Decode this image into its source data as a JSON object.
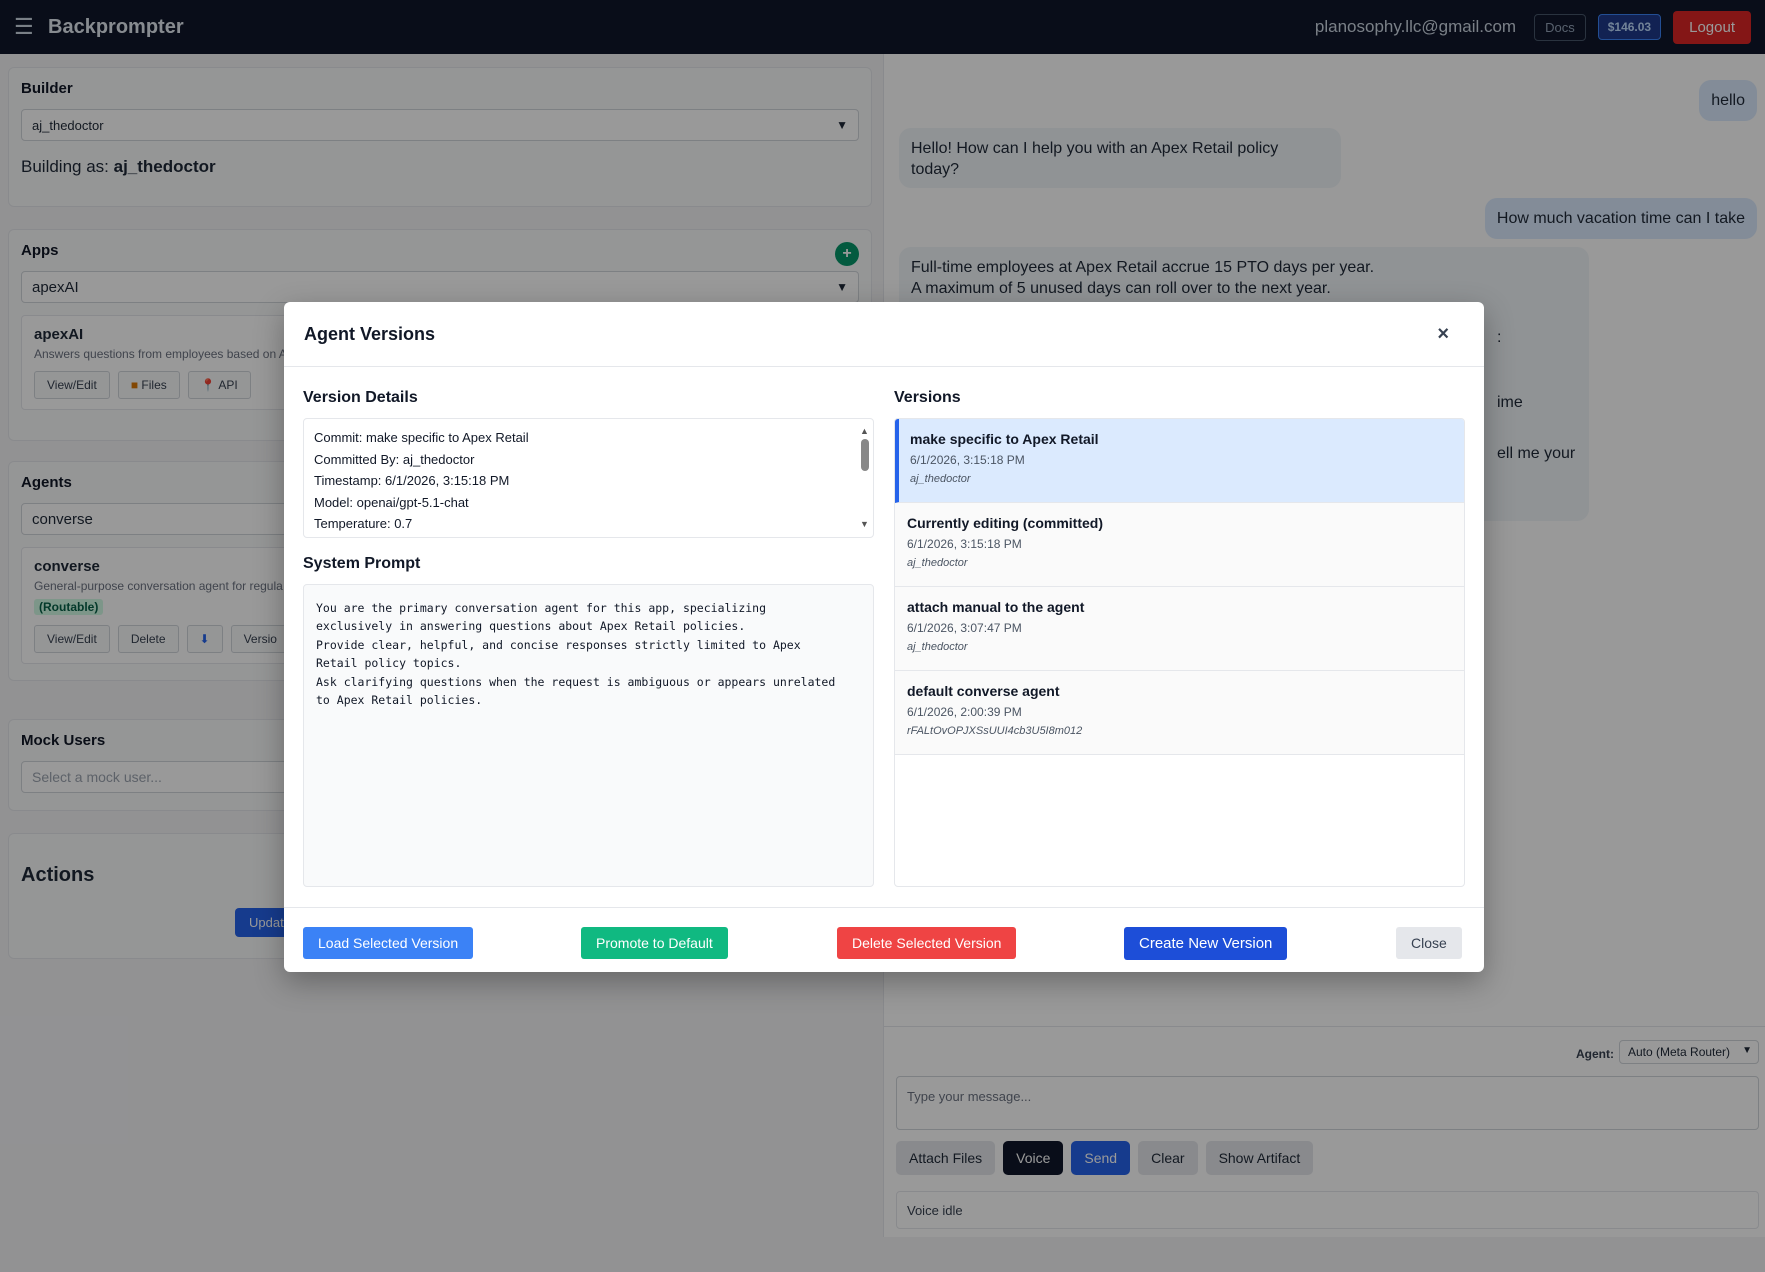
{
  "header": {
    "brand": "Backprompter",
    "email": "planosophy.llc@gmail.com",
    "docs_label": "Docs",
    "balance": "$146.03",
    "logout_label": "Logout"
  },
  "builder": {
    "title": "Builder",
    "selected": "aj_thedoctor",
    "building_as_prefix": "Building as: ",
    "building_as_name": "aj_thedoctor"
  },
  "apps": {
    "title": "Apps",
    "add_label": "+",
    "selected": "apexAI",
    "card_title": "apexAI",
    "card_desc": "Answers questions from employees based on A",
    "btn_view_edit": "View/Edit",
    "btn_files": "Files",
    "btn_api": "API"
  },
  "agents": {
    "title": "Agents",
    "selected": "converse",
    "card_title": "converse",
    "card_desc": "General-purpose conversation agent for regula",
    "badge": "(Routable)",
    "btn_view_edit": "View/Edit",
    "btn_delete": "Delete",
    "btn_versions": "Versio"
  },
  "mock_users": {
    "title": "Mock Users",
    "placeholder": "Select a mock user..."
  },
  "actions": {
    "title": "Actions",
    "update_label": "Update"
  },
  "chat": {
    "messages": [
      {
        "role": "user",
        "text": "hello"
      },
      {
        "role": "bot",
        "text": "Hello! How can I help you with an Apex Retail policy today?"
      },
      {
        "role": "user",
        "text": "How much vacation time can I take"
      },
      {
        "role": "bot",
        "line1": "Full-time employees at Apex Retail accrue 15 PTO days per year.",
        "line2": "A maximum of 5 unused days can roll over to the next year.",
        "frag1": ":",
        "frag2": "ime",
        "frag3": "ell me your"
      }
    ],
    "agent_label": "Agent:",
    "agent_selected": "Auto (Meta Router)",
    "input_placeholder": "Type your message...",
    "btn_attach": "Attach Files",
    "btn_voice": "Voice",
    "btn_send": "Send",
    "btn_clear": "Clear",
    "btn_artifact": "Show Artifact",
    "voice_status": "Voice idle"
  },
  "modal": {
    "title": "Agent Versions",
    "close_x": "×",
    "details_title": "Version Details",
    "details": [
      {
        "label": "Commit: ",
        "value": "make specific to Apex Retail"
      },
      {
        "label": "Committed By: ",
        "value": "aj_thedoctor"
      },
      {
        "label": "Timestamp: ",
        "value": "6/1/2026, 3:15:18 PM"
      },
      {
        "label": "Model: ",
        "value": "openai/gpt-5.1-chat"
      },
      {
        "label": "Temperature: ",
        "value": "0.7"
      }
    ],
    "prompt_title": "System Prompt",
    "system_prompt": "You are the primary conversation agent for this app, specializing\nexclusively in answering questions about Apex Retail policies.\nProvide clear, helpful, and concise responses strictly limited to Apex\nRetail policy topics.\nAsk clarifying questions when the request is ambiguous or appears unrelated\nto Apex Retail policies.",
    "versions_title": "Versions",
    "versions": [
      {
        "title": "make specific to Apex Retail",
        "time": "6/1/2026, 3:15:18 PM",
        "user": "aj_thedoctor",
        "selected": true
      },
      {
        "title": "Currently editing (committed)",
        "time": "6/1/2026, 3:15:18 PM",
        "user": "aj_thedoctor",
        "selected": false
      },
      {
        "title": "attach manual to the agent",
        "time": "6/1/2026, 3:07:47 PM",
        "user": "aj_thedoctor",
        "selected": false
      },
      {
        "title": "default converse agent",
        "time": "6/1/2026, 2:00:39 PM",
        "user": "rFALtOvOPJXSsUUI4cb3U5I8m012",
        "selected": false
      }
    ],
    "btn_load": "Load Selected Version",
    "btn_promote": "Promote to Default",
    "btn_delete": "Delete Selected Version",
    "btn_create": "Create New Version",
    "btn_close": "Close"
  }
}
